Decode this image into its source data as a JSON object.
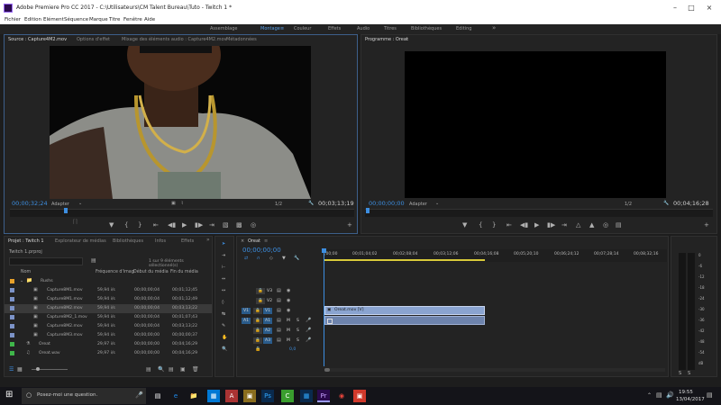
{
  "titlebar": {
    "title": "Adobe Premiere Pro CC 2017 - C:\\Utilisateurs\\CM Talent Bureau\\Tuto - Twitch 1 *"
  },
  "menu": [
    "Fichier",
    "Edition",
    "Elément",
    "Séquence",
    "Marque",
    "Titre",
    "Fenêtre",
    "Aide"
  ],
  "workspaces": [
    "Assemblage",
    "Montage",
    "Couleur",
    "Effets",
    "Audio",
    "Titres",
    "Bibliothèques",
    "Editing"
  ],
  "workspace_more": "»",
  "source": {
    "tabs": [
      "Source : Capture4M2.mov",
      "Options d'effet",
      "Mixage des éléments audio : Capture4M2.mov",
      "Métadonnées"
    ],
    "timecode": "00;00;32;24",
    "fit": "Adapter",
    "ratio": "1/2",
    "duration": "00;03;13;19"
  },
  "program": {
    "tab": "Programme : Oreat",
    "timecode": "00;00;00;00",
    "fit": "Adapter",
    "ratio": "1/2",
    "duration": "00;04;16;28"
  },
  "project": {
    "tabs": [
      "Projet : Twitch 1",
      "Explorateur de médias",
      "Bibliothèques",
      "Infos",
      "Effets"
    ],
    "file": "Twitch 1.prproj",
    "selection": "1 sur 9 éléments sélectionné(s)",
    "columns": [
      "Nom",
      "Fréquence d'imag",
      "Début du média",
      "Fin du média"
    ],
    "folder": "Rushs",
    "rows": [
      {
        "name": "Capture8M1.mov",
        "fps": "59,94 i/s",
        "start": "00;00;00;04",
        "end": "00;01;12;45"
      },
      {
        "name": "Capture8M1.mov",
        "fps": "59,94 i/s",
        "start": "00;00;00;04",
        "end": "00;01;12;49"
      },
      {
        "name": "Capture8M2.mov",
        "fps": "59,94 i/s",
        "start": "00;00;00;04",
        "end": "00;03;13;22"
      },
      {
        "name": "Capture8M2_1.mov",
        "fps": "59,94 i/s",
        "start": "00;00;00;04",
        "end": "00;01;07;43"
      },
      {
        "name": "Capture8M2.mov",
        "fps": "59,94 i/s",
        "start": "00;00;00;04",
        "end": "00;03;13;22"
      },
      {
        "name": "Capture8M3.mov",
        "fps": "59,94 i/s",
        "start": "00;00;00;00",
        "end": "00;00;00;37"
      }
    ],
    "seq_rows": [
      {
        "name": "Oreat",
        "fps": "29,97 i/s",
        "start": "00;00;00;00",
        "end": "00;04;16;29"
      },
      {
        "name": "Oreat.wav",
        "fps": "29,97 i/s",
        "start": "00;00;00;00",
        "end": "00;04;16;29"
      }
    ]
  },
  "timeline": {
    "tab": "Oreat",
    "timecode": "00;00;00;00",
    "ruler": [
      ";00;00",
      "00;01;04;02",
      "00;02;08;04",
      "00;03;12;06",
      "00;04;16;08",
      "00;05;20;10",
      "00;06;24;12",
      "00;07;28;14",
      "00;08;32;16"
    ],
    "video_tracks": [
      "V3",
      "V2",
      "V1"
    ],
    "audio_tracks": [
      "A1",
      "A2",
      "A3"
    ],
    "clip_label": "Oreat.mov [V]",
    "master": "0,0"
  },
  "meter_labels": [
    "0",
    "-6",
    "-12",
    "-18",
    "-24",
    "-30",
    "-36",
    "-42",
    "-48",
    "-54",
    "dB"
  ],
  "taskbar": {
    "search": "Posez-moi une question.",
    "time": "19:55",
    "date": "13/04/2017"
  },
  "colors": {
    "accent": "#3d8ee0",
    "clip": "#8aa4d0",
    "premiere": "#2b0a4d"
  }
}
